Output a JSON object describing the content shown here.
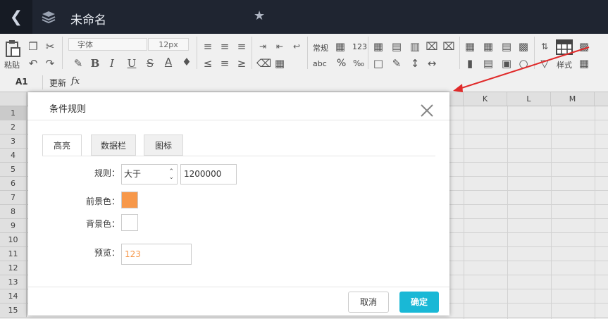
{
  "app": {
    "doc_title": "未命名",
    "back_icon": "chevron-left-icon",
    "layers_icon": "layers-icon",
    "star_icon": "star-icon"
  },
  "ribbon": {
    "paste_label": "粘贴",
    "font_name": "字体",
    "font_size": "12px",
    "format_regular": "常规",
    "format_number": "123",
    "format_abc": "abc",
    "format_percent": "%",
    "style_label": "样式"
  },
  "formula_bar": {
    "cell_ref": "A1",
    "update_label": "更新",
    "fx_label": "fx"
  },
  "grid": {
    "columns": [
      "K",
      "L",
      "M"
    ],
    "rows": [
      "1",
      "2",
      "3",
      "4",
      "5",
      "6",
      "7",
      "8",
      "9",
      "10",
      "11",
      "12",
      "13",
      "14",
      "15"
    ]
  },
  "dialog": {
    "title": "条件规则",
    "tabs": [
      "高亮",
      "数据栏",
      "图标"
    ],
    "rule_label": "规则：",
    "rule_operator": "大于",
    "rule_value": "1200000",
    "fg_label": "前景色：",
    "bg_label": "背景色：",
    "preview_label": "预览：",
    "preview_text": "123",
    "fg_color": "#f7984a",
    "bg_color": "#ffffff",
    "preview_color": "#f7984a",
    "cancel_label": "取消",
    "ok_label": "确定"
  },
  "colors": {
    "topbar": "#1f2531",
    "accent": "#19b8d6",
    "annotation_arrow": "#e02a2a"
  }
}
